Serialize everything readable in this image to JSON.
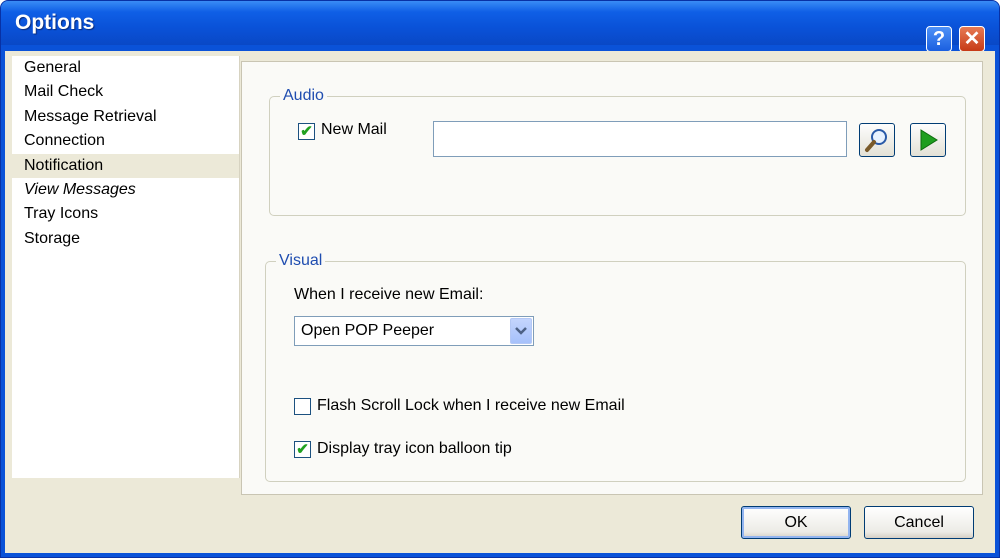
{
  "window": {
    "title": "Options",
    "help_glyph": "?",
    "close_glyph": "✕"
  },
  "nav": {
    "items": [
      {
        "label": "General"
      },
      {
        "label": "Mail Check"
      },
      {
        "label": "Message Retrieval"
      },
      {
        "label": "Connection"
      },
      {
        "label": "Notification",
        "selected": true
      },
      {
        "label": "View Messages",
        "italic": true
      },
      {
        "label": "Tray Icons"
      },
      {
        "label": "Storage"
      }
    ]
  },
  "audio": {
    "legend": "Audio",
    "new_mail_label": "New Mail",
    "new_mail_checked": true,
    "sound_file_value": "",
    "browse_icon": "magnifier-icon",
    "play_icon": "play-icon"
  },
  "visual": {
    "legend": "Visual",
    "when_receive_label": "When I receive new Email:",
    "action_selected": "Open POP Peeper",
    "flash_scroll_label": "Flash Scroll Lock when I receive new Email",
    "flash_scroll_checked": false,
    "balloon_label": "Display tray icon balloon tip",
    "balloon_checked": true,
    "check_glyph": "✔"
  },
  "buttons": {
    "ok": "OK",
    "cancel": "Cancel"
  },
  "colors": {
    "titlebar": "#0a52d8",
    "legend_text": "#1f4db0",
    "face": "#ece9d8",
    "check_green": "#21a121"
  }
}
